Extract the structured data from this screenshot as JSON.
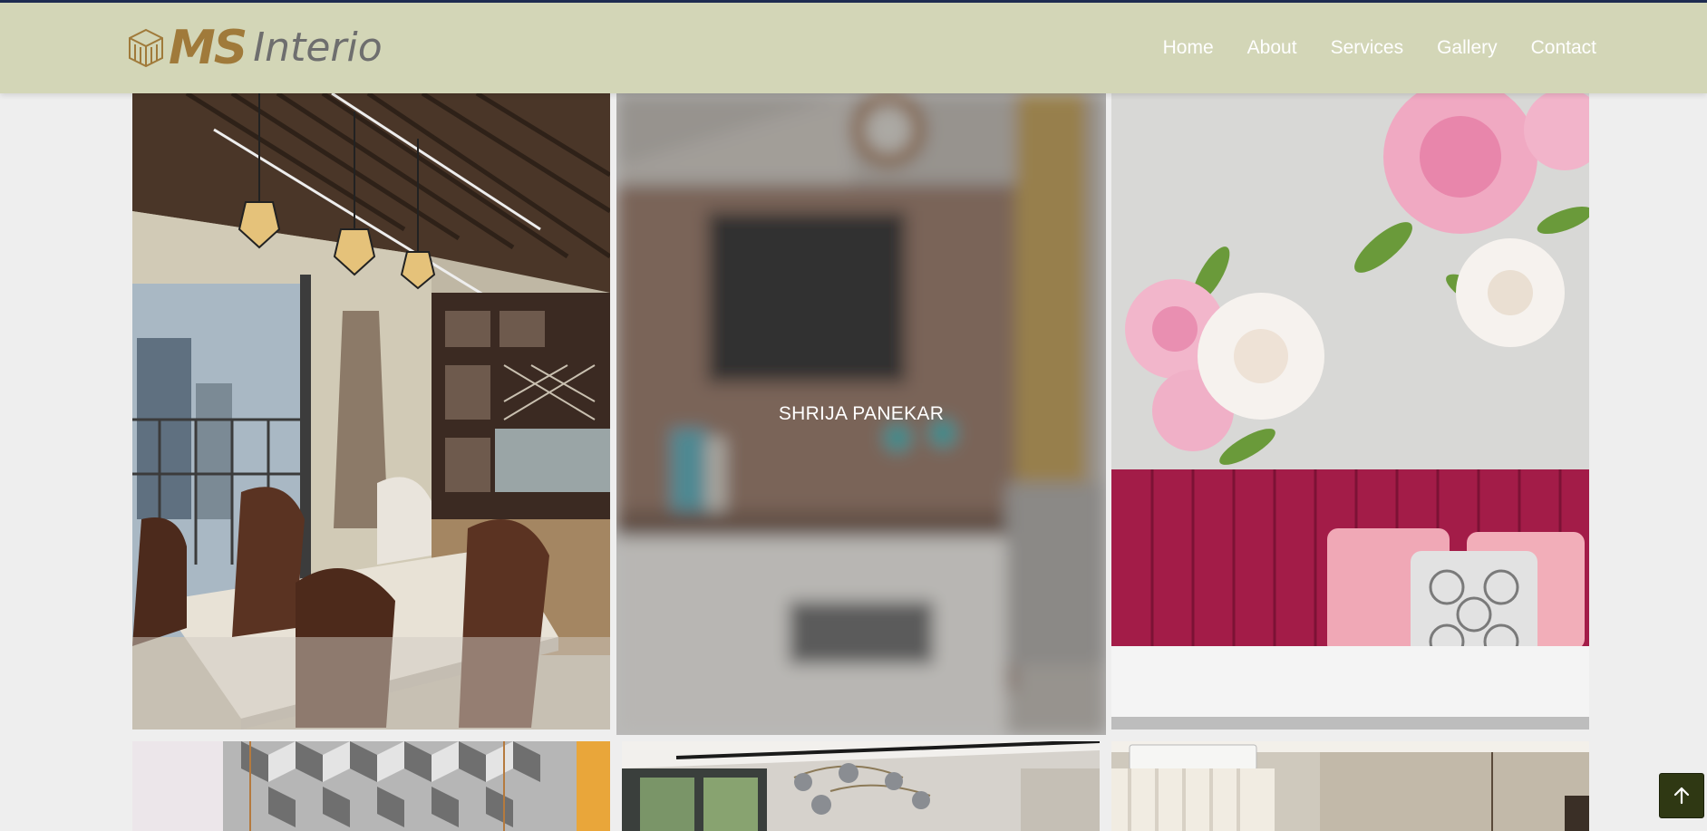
{
  "brand": {
    "name_bold": "MS",
    "name_rest": "Interio",
    "mark_icon": "cube-lines-icon"
  },
  "nav": {
    "items": [
      {
        "label": "Home"
      },
      {
        "label": "About"
      },
      {
        "label": "Services"
      },
      {
        "label": "Gallery"
      },
      {
        "label": "Contact"
      }
    ]
  },
  "gallery": {
    "tiles": [
      {
        "subject": "dining-room-photo"
      },
      {
        "subject": "living-room-tv-unit-photo",
        "hover_label": "SHRIJA PANEKAR"
      },
      {
        "subject": "floral-wall-bedroom-photo"
      },
      {
        "subject": "geometric-wallpaper-photo"
      },
      {
        "subject": "chandelier-living-room-photo"
      },
      {
        "subject": "curtain-room-photo"
      }
    ]
  },
  "back_to_top": {
    "icon": "arrow-up-icon"
  },
  "colors": {
    "navbar": "#d3d6b7",
    "top_border": "#1f2d52",
    "brand_gold": "#a07a3a",
    "brand_gray": "#6e6e6e",
    "back_to_top": "#2f3813"
  }
}
